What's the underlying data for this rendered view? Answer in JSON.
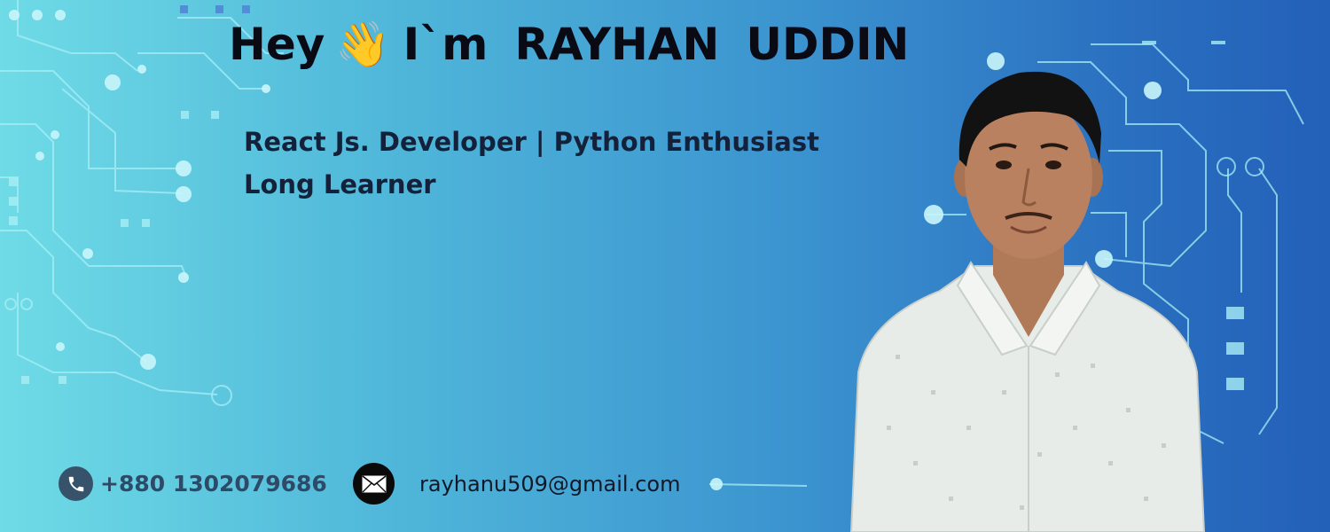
{
  "headline": {
    "greeting": "Hey",
    "wave_emoji": "👋",
    "intro": "I`m",
    "first_name": "RAYHAN",
    "last_name": "UDDIN"
  },
  "tagline": {
    "line1": "React Js. Developer | Python Enthusiast",
    "line2": "Long Learner"
  },
  "contact": {
    "phone": "+880 1302079686",
    "email": "rayhanu509@gmail.com",
    "phone_icon": "phone-icon",
    "mail_icon": "mail-icon"
  },
  "colors": {
    "background_start": "#6fdbe6",
    "background_end": "#2360b8",
    "headline": "#0a0a14",
    "tagline": "#13213a",
    "phone_text": "#2d4a66"
  }
}
